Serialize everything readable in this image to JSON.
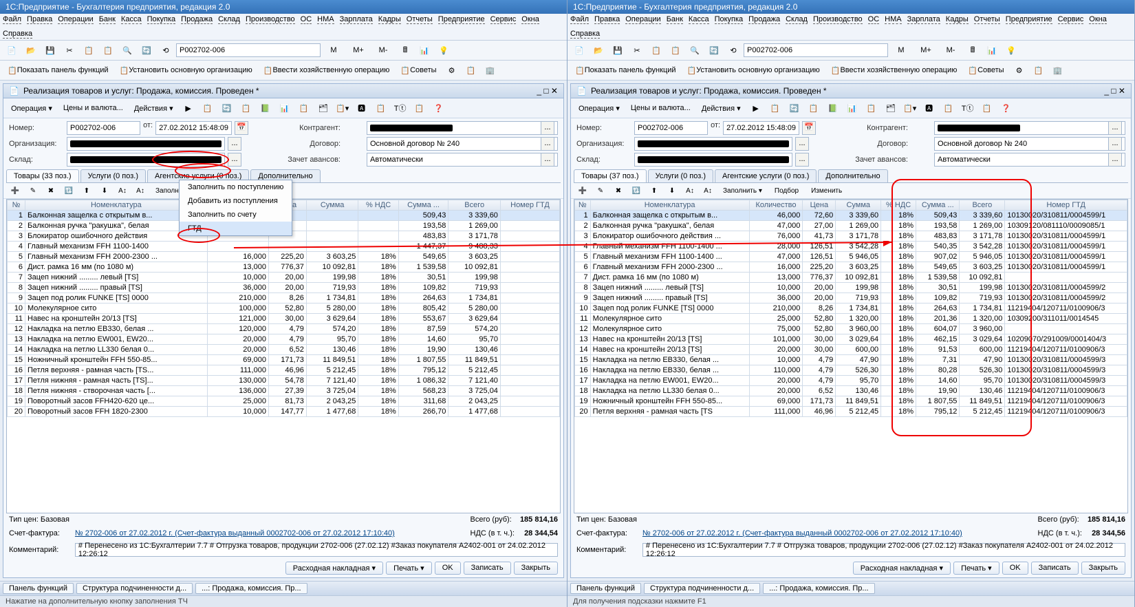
{
  "win_title": "1С:Предприятие - Бухгалтерия предприятия, редакция 2.0",
  "menubar": [
    "Файл",
    "Правка",
    "Операции",
    "Банк",
    "Касса",
    "Покупка",
    "Продажа",
    "Склад",
    "Производство",
    "ОС",
    "НМА",
    "Зарплата",
    "Кадры",
    "Отчеты",
    "Предприятие",
    "Сервис",
    "Окна",
    "Справка"
  ],
  "addr": "Р002702-006",
  "mbtns": [
    "М",
    "М+",
    "М-"
  ],
  "tb2": [
    "Показать панель функций",
    "Установить основную организацию",
    "Ввести хозяйственную операцию",
    "Советы"
  ],
  "doc_title": "Реализация товаров и услуг: Продажа, комиссия. Проведен *",
  "doc_tb": {
    "op": "Операция",
    "pv": "Цены и валюта...",
    "act": "Действия"
  },
  "form": {
    "num_l": "Номер:",
    "num": "Р002702-006",
    "from": "от:",
    "date": "27.02.2012 15:48:09",
    "kont_l": "Контрагент:",
    "org_l": "Организация:",
    "dog_l": "Договор:",
    "dog": "Основной договор № 240",
    "skl_l": "Склад:",
    "zav_l": "Зачет авансов:",
    "zav": "Автоматически"
  },
  "gridtb": {
    "fill": "Заполнить",
    "pick": "Подбор",
    "chg": "Изменить"
  },
  "popup": [
    "Заполнить по поступлению",
    "Добавить из поступления",
    "Заполнить по счету",
    "ГТД"
  ],
  "cols": [
    "№",
    "Номенклатура",
    "Количество",
    "Цена",
    "Сумма",
    "% НДС",
    "Сумма ...",
    "Всего",
    "Номер ГТД"
  ],
  "left": {
    "tabs": [
      "Товары (33 поз.)",
      "Услуги (0 поз.)",
      "Агентские услуги (0 поз.)",
      "Дополнительно"
    ],
    "rows": [
      [
        "1",
        "Балконная защелка с открытым в...",
        "",
        "",
        "",
        "",
        "509,43",
        "3 339,60",
        ""
      ],
      [
        "2",
        "Балконная ручка \"ракушка\", белая",
        "",
        "",
        "",
        "",
        "193,58",
        "1 269,00",
        ""
      ],
      [
        "3",
        "Блокиратор ошибочного действия",
        "",
        "",
        "",
        "",
        "483,83",
        "3 171,78",
        ""
      ],
      [
        "4",
        "Главный механизм FFH 1100-1400",
        "",
        "",
        "",
        "",
        "1 447,37",
        "9 488,33",
        ""
      ],
      [
        "5",
        "Главный механизм FFH 2000-2300 ...",
        "16,000",
        "225,20",
        "3 603,25",
        "18%",
        "549,65",
        "3 603,25",
        ""
      ],
      [
        "6",
        "Дист. рамка 16 мм (по 1080 м)",
        "13,000",
        "776,37",
        "10 092,81",
        "18%",
        "1 539,58",
        "10 092,81",
        ""
      ],
      [
        "7",
        "Зацеп нижний ......... левый [TS]",
        "10,000",
        "20,00",
        "199,98",
        "18%",
        "30,51",
        "199,98",
        ""
      ],
      [
        "8",
        "Зацеп нижний ......... правый [TS]",
        "36,000",
        "20,00",
        "719,93",
        "18%",
        "109,82",
        "719,93",
        ""
      ],
      [
        "9",
        "Зацеп под ролик FUNKE [TS] 0000",
        "210,000",
        "8,26",
        "1 734,81",
        "18%",
        "264,63",
        "1 734,81",
        ""
      ],
      [
        "10",
        "Молекулярное сито",
        "100,000",
        "52,80",
        "5 280,00",
        "18%",
        "805,42",
        "5 280,00",
        ""
      ],
      [
        "11",
        "Навес на кронштейн 20/13 [TS]",
        "121,000",
        "30,00",
        "3 629,64",
        "18%",
        "553,67",
        "3 629,64",
        ""
      ],
      [
        "12",
        "Накладка на петлю EB330, белая ...",
        "120,000",
        "4,79",
        "574,20",
        "18%",
        "87,59",
        "574,20",
        ""
      ],
      [
        "13",
        "Накладка на петлю EW001, EW20...",
        "20,000",
        "4,79",
        "95,70",
        "18%",
        "14,60",
        "95,70",
        ""
      ],
      [
        "14",
        "Накладка на петлю LL330 белая 0...",
        "20,000",
        "6,52",
        "130,46",
        "18%",
        "19,90",
        "130,46",
        ""
      ],
      [
        "15",
        "Ножничный кронштейн FFH 550-85...",
        "69,000",
        "171,73",
        "11 849,51",
        "18%",
        "1 807,55",
        "11 849,51",
        ""
      ],
      [
        "16",
        "Петля верхняя - рамная часть [TS...",
        "111,000",
        "46,96",
        "5 212,45",
        "18%",
        "795,12",
        "5 212,45",
        ""
      ],
      [
        "17",
        "Петля нижняя - рамная часть [TS]...",
        "130,000",
        "54,78",
        "7 121,40",
        "18%",
        "1 086,32",
        "7 121,40",
        ""
      ],
      [
        "18",
        "Петля нижняя - створочная часть [...",
        "136,000",
        "27,39",
        "3 725,04",
        "18%",
        "568,23",
        "3 725,04",
        ""
      ],
      [
        "19",
        "Поворотный засов FFH420-620 це...",
        "25,000",
        "81,73",
        "2 043,25",
        "18%",
        "311,68",
        "2 043,25",
        ""
      ],
      [
        "20",
        "Поворотный засов FFH 1820-2300",
        "10,000",
        "147,77",
        "1 477,68",
        "18%",
        "266,70",
        "1 477,68",
        ""
      ]
    ]
  },
  "right": {
    "tabs": [
      "Товары (37 поз.)",
      "Услуги (0 поз.)",
      "Агентские услуги (0 поз.)",
      "Дополнительно"
    ],
    "rows": [
      [
        "1",
        "Балконная защелка с открытым в...",
        "46,000",
        "72,60",
        "3 339,60",
        "18%",
        "509,43",
        "3 339,60",
        "10130020/310811/0004599/1"
      ],
      [
        "2",
        "Балконная ручка \"ракушка\", белая",
        "47,000",
        "27,00",
        "1 269,00",
        "18%",
        "193,58",
        "1 269,00",
        "10309120/081110/0009085/1"
      ],
      [
        "3",
        "Блокиратор ошибочного действия ...",
        "76,000",
        "41,73",
        "3 171,78",
        "18%",
        "483,83",
        "3 171,78",
        "10130020/310811/0004599/1"
      ],
      [
        "4",
        "Главный механизм FFH 1100-1400 ...",
        "28,000",
        "126,51",
        "3 542,28",
        "18%",
        "540,35",
        "3 542,28",
        "10130020/310811/0004599/1"
      ],
      [
        "5",
        "Главный механизм FFH 1100-1400 ...",
        "47,000",
        "126,51",
        "5 946,05",
        "18%",
        "907,02",
        "5 946,05",
        "10130020/310811/0004599/1"
      ],
      [
        "6",
        "Главный механизм FFH 2000-2300 ...",
        "16,000",
        "225,20",
        "3 603,25",
        "18%",
        "549,65",
        "3 603,25",
        "10130020/310811/0004599/1"
      ],
      [
        "7",
        "Дист. рамка 16 мм (по 1080 м)",
        "13,000",
        "776,37",
        "10 092,81",
        "18%",
        "1 539,58",
        "10 092,81",
        ""
      ],
      [
        "8",
        "Зацеп нижний ......... левый [TS]",
        "10,000",
        "20,00",
        "199,98",
        "18%",
        "30,51",
        "199,98",
        "10130020/310811/0004599/2"
      ],
      [
        "9",
        "Зацеп нижний ......... правый [TS]",
        "36,000",
        "20,00",
        "719,93",
        "18%",
        "109,82",
        "719,93",
        "10130020/310811/0004599/2"
      ],
      [
        "10",
        "Зацеп под ролик FUNKE [TS] 0000",
        "210,000",
        "8,26",
        "1 734,81",
        "18%",
        "264,63",
        "1 734,81",
        "11219404/120711/0100906/3"
      ],
      [
        "11",
        "Молекулярное сито",
        "25,000",
        "52,80",
        "1 320,00",
        "18%",
        "201,36",
        "1 320,00",
        "10309200/311011/0014545"
      ],
      [
        "12",
        "Молекулярное сито",
        "75,000",
        "52,80",
        "3 960,00",
        "18%",
        "604,07",
        "3 960,00",
        ""
      ],
      [
        "13",
        "Навес на кронштейн 20/13 [TS]",
        "101,000",
        "30,00",
        "3 029,64",
        "18%",
        "462,15",
        "3 029,64",
        "10209070/291009/0001404/3"
      ],
      [
        "14",
        "Навес на кронштейн 20/13 [TS]",
        "20,000",
        "30,00",
        "600,00",
        "18%",
        "91,53",
        "600,00",
        "11219404/120711/0100906/3"
      ],
      [
        "15",
        "Накладка на петлю EB330, белая ...",
        "10,000",
        "4,79",
        "47,90",
        "18%",
        "7,31",
        "47,90",
        "10130020/310811/0004599/3"
      ],
      [
        "16",
        "Накладка на петлю EB330, белая ...",
        "110,000",
        "4,79",
        "526,30",
        "18%",
        "80,28",
        "526,30",
        "10130020/310811/0004599/3"
      ],
      [
        "17",
        "Накладка на петлю EW001, EW20...",
        "20,000",
        "4,79",
        "95,70",
        "18%",
        "14,60",
        "95,70",
        "10130020/310811/0004599/3"
      ],
      [
        "18",
        "Накладка на петлю LL330 белая 0...",
        "20,000",
        "6,52",
        "130,46",
        "18%",
        "19,90",
        "130,46",
        "11219404/120711/0100906/3"
      ],
      [
        "19",
        "Ножничный кронштейн FFH 550-85...",
        "69,000",
        "171,73",
        "11 849,51",
        "18%",
        "1 807,55",
        "11 849,51",
        "11219404/120711/0100906/3"
      ],
      [
        "20",
        "Петля верхняя - рамная часть [TS",
        "111,000",
        "46,96",
        "5 212,45",
        "18%",
        "795,12",
        "5 212,45",
        "11219404/120711/0100906/3"
      ]
    ]
  },
  "foot": {
    "tip_l": "Тип цен:",
    "tip": "Базовая",
    "tot_l": "Всего (руб):",
    "tot": "185 814,16",
    "sf_l": "Счет-фактура:",
    "sf": "№ 2702-006 от 27.02.2012 г. (Счет-фактура выданный 0002702-006 от 27.02.2012 17:10:40)",
    "nds_l": "НДС (в т. ч.):",
    "nds_left": "28 344,54",
    "nds_right": "28 344,56",
    "kom_l": "Комментарий:",
    "kom": "# Перенесено из 1С:Бухгалтерии 7.7 # Отгрузка товаров, продукции 2702-006 (27.02.12) #Заказ покупателя А2402-001 от 24.02.2012 12:26:12"
  },
  "btns": [
    "Расходная накладная",
    "Печать",
    "OK",
    "Записать",
    "Закрыть"
  ],
  "tasks": [
    "Панель функций",
    "Структура подчиненности д...",
    "...: Продажа, комиссия. Пр..."
  ],
  "status_left": "Нажатие на дополнительную кнопку заполнения ТЧ",
  "status_right": "Для получения подсказки нажмите F1"
}
